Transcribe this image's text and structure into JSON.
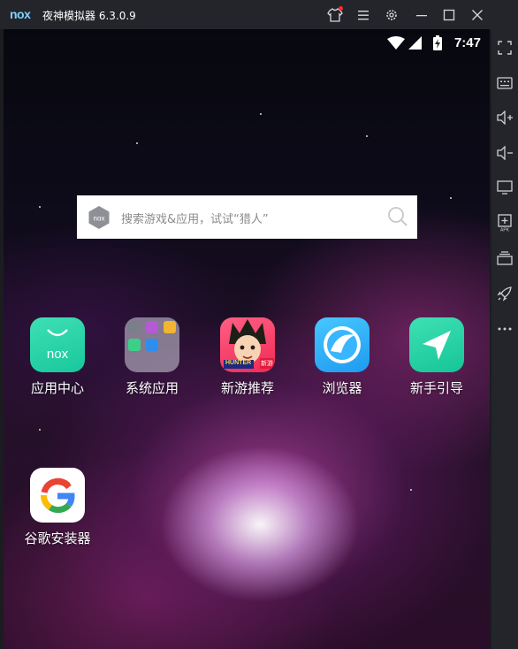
{
  "window": {
    "logo": "nox",
    "title": "夜神模拟器 6.3.0.9"
  },
  "status_bar": {
    "time": "7:47"
  },
  "search": {
    "placeholder": "搜索游戏&应用，试试“猎人”"
  },
  "apps": [
    {
      "label": "应用中心",
      "icon": "nox-app-center-icon"
    },
    {
      "label": "系统应用",
      "icon": "system-apps-folder-icon"
    },
    {
      "label": "新游推荐",
      "icon": "hunter-game-icon"
    },
    {
      "label": "浏览器",
      "icon": "browser-icon"
    },
    {
      "label": "新手引导",
      "icon": "send-arrow-icon"
    },
    {
      "label": "谷歌安装器",
      "icon": "google-g-icon"
    }
  ],
  "app_badges": {
    "hunter_text": "HUNTER",
    "new_tag": "新游"
  },
  "colors": {
    "titlebar": "#23252b",
    "accent_green": "#1fcf9f",
    "accent_blue": "#2aaef5",
    "notification_dot": "#ff2a2a"
  }
}
